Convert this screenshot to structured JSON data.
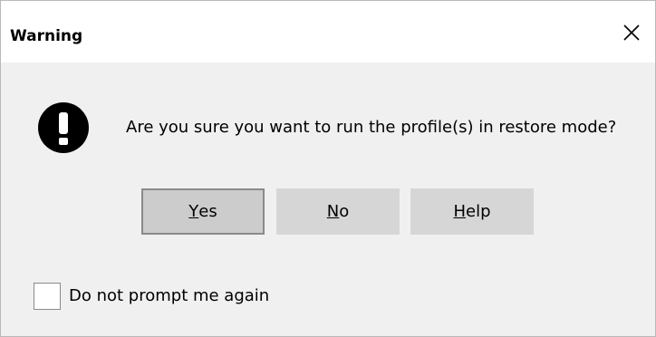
{
  "dialog": {
    "title": "Warning",
    "close_icon": "close-icon",
    "alert_icon": "exclamation-circle-icon",
    "message": "Are you sure you want to run the profile(s) in restore mode?"
  },
  "buttons": {
    "yes": {
      "mnemonic": "Y",
      "rest": "es"
    },
    "no": {
      "mnemonic": "N",
      "rest": "o"
    },
    "help": {
      "mnemonic": "H",
      "rest": "elp"
    }
  },
  "checkbox": {
    "label": "Do not prompt me again",
    "checked": false
  },
  "colors": {
    "titlebar_bg": "#ffffff",
    "body_bg": "#f0f0f0",
    "button_bg": "#d6d6d6",
    "default_button_border": "#8a8a8a"
  }
}
